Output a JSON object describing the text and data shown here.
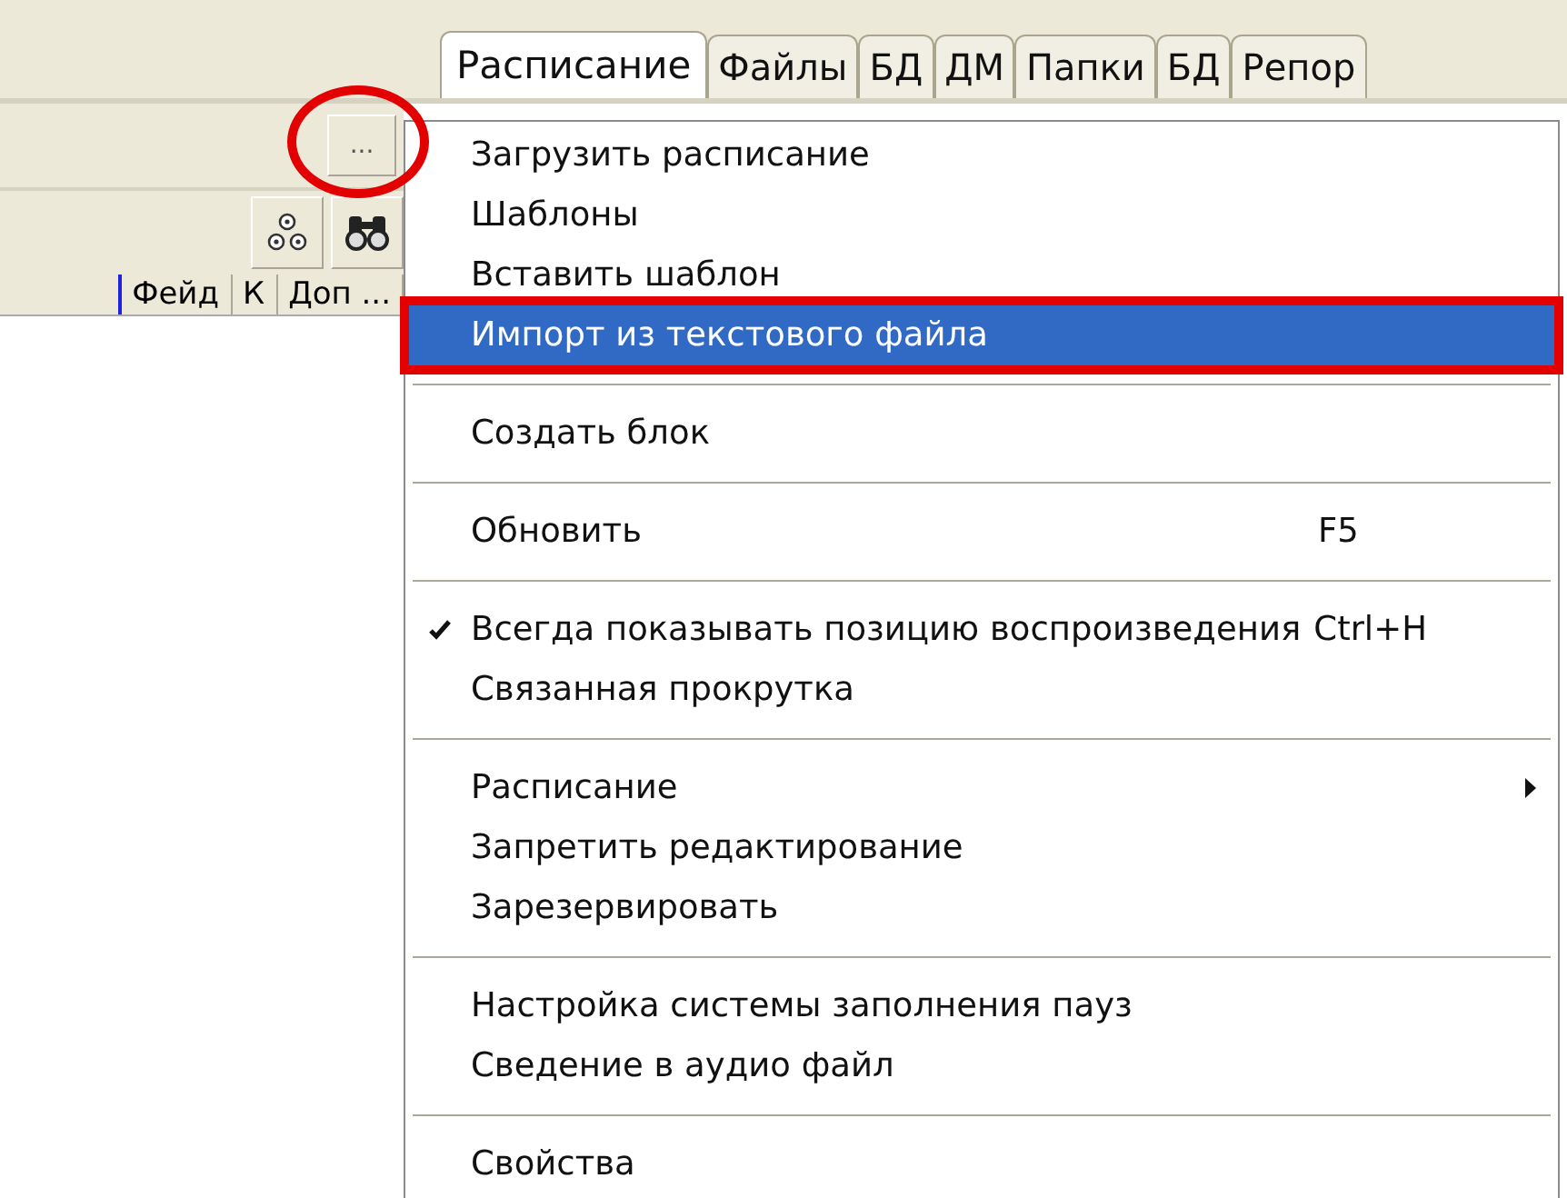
{
  "tabs": [
    {
      "label": "Расписание",
      "selected": true
    },
    {
      "label": "Файлы",
      "selected": false
    },
    {
      "label": "БД",
      "selected": false
    },
    {
      "label": "ДМ",
      "selected": false
    },
    {
      "label": "Папки",
      "selected": false
    },
    {
      "label": "БД",
      "selected": false
    },
    {
      "label": "Репор",
      "selected": false
    }
  ],
  "browse_button": {
    "label": "...",
    "annotated": true
  },
  "columns": [
    "Фейд",
    "К",
    "Доп ..."
  ],
  "menu": [
    {
      "kind": "item",
      "label": "Загрузить расписание",
      "checked": false,
      "submenu": false,
      "selected": false,
      "annotated": false
    },
    {
      "kind": "item",
      "label": "Шаблоны",
      "checked": false,
      "submenu": false,
      "selected": false,
      "annotated": false
    },
    {
      "kind": "item",
      "label": "Вставить шаблон",
      "checked": false,
      "submenu": false,
      "selected": false,
      "annotated": false
    },
    {
      "kind": "item",
      "label": "Импорт из текстового файла",
      "checked": false,
      "submenu": false,
      "selected": true,
      "annotated": true
    },
    {
      "kind": "separator"
    },
    {
      "kind": "item",
      "label": "Создать блок",
      "checked": false,
      "submenu": false,
      "selected": false,
      "annotated": false
    },
    {
      "kind": "separator"
    },
    {
      "kind": "item",
      "label": "Обновить",
      "shortcut": "F5",
      "checked": false,
      "submenu": false,
      "selected": false,
      "annotated": false
    },
    {
      "kind": "separator"
    },
    {
      "kind": "item",
      "label": "Всегда показывать позицию воспроизведения",
      "shortcut": "Ctrl+H",
      "checked": true,
      "submenu": false,
      "selected": false,
      "annotated": false
    },
    {
      "kind": "item",
      "label": "Связанная прокрутка",
      "checked": false,
      "submenu": false,
      "selected": false,
      "annotated": false
    },
    {
      "kind": "separator"
    },
    {
      "kind": "item",
      "label": "Расписание",
      "checked": false,
      "submenu": true,
      "selected": false,
      "annotated": false
    },
    {
      "kind": "item",
      "label": "Запретить редактирование",
      "checked": false,
      "submenu": false,
      "selected": false,
      "annotated": false
    },
    {
      "kind": "item",
      "label": "Зарезервировать",
      "checked": false,
      "submenu": false,
      "selected": false,
      "annotated": false
    },
    {
      "kind": "separator"
    },
    {
      "kind": "item",
      "label": "Настройка системы заполнения пауз",
      "checked": false,
      "submenu": false,
      "selected": false,
      "annotated": false
    },
    {
      "kind": "item",
      "label": "Сведение в аудио файл",
      "checked": false,
      "submenu": false,
      "selected": false,
      "annotated": false
    },
    {
      "kind": "separator"
    },
    {
      "kind": "item",
      "label": "Свойства",
      "checked": false,
      "submenu": false,
      "selected": false,
      "annotated": false
    }
  ]
}
